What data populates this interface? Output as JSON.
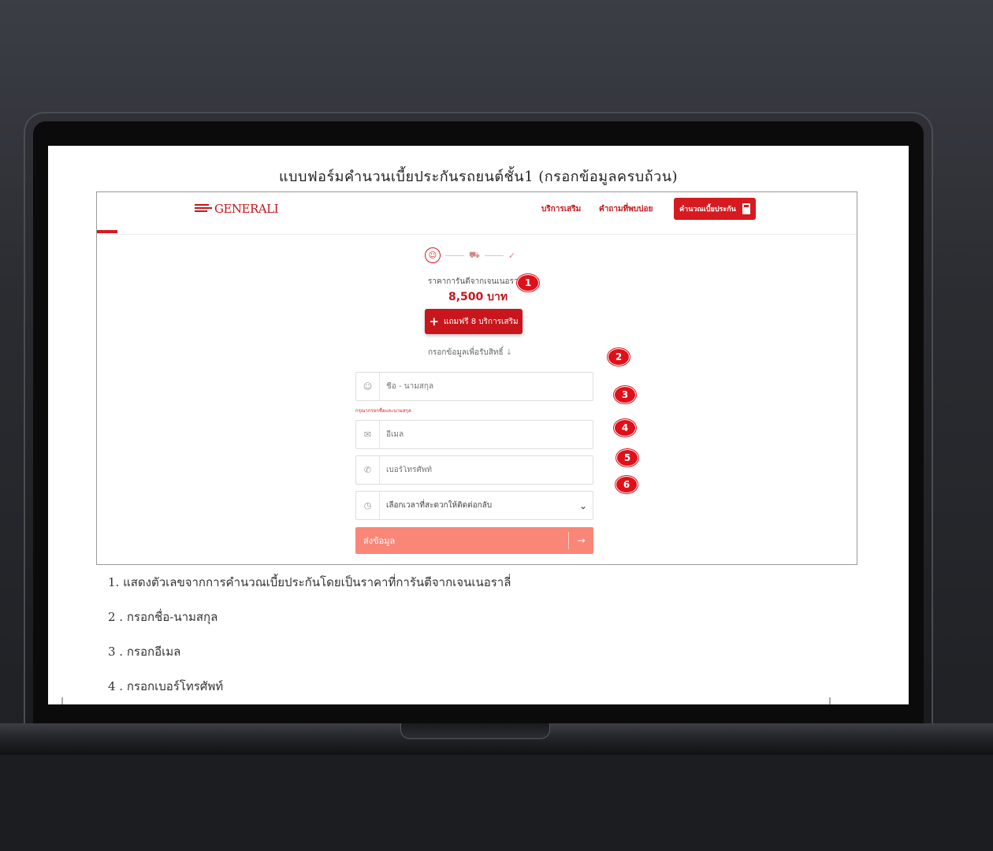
{
  "document": {
    "title": "แบบฟอร์มคำนวนเบี้ยประกันรถยนต์ชั้น1 (กรอกข้อมูลครบถ้วน)",
    "notes": [
      "1. แสดงตัวเลขจากการคำนวณเบี้ยประกันโดยเป็นราคาที่การันตีจากเจนเนอราลี่",
      "2 . กรอกชื่อ-นามสกุล",
      "3 . กรอกอีเมล",
      "4 . กรอกเบอร์โทรศัพท์"
    ]
  },
  "site": {
    "logo_text": "GENERALI",
    "nav": {
      "services": "บริการเสริม",
      "faq": "คำถามที่พบบ่อย",
      "cta": "คำนวณเบี้ยประกัน"
    },
    "steps_icons": [
      "person-icon",
      "car-icon",
      "check-icon"
    ],
    "price_label": "ราคาการันตีจากเจนเนอราลี่",
    "price": "8,500 บาท",
    "free_button": "แถมฟรี 8 บริการเสริม",
    "fill_hint": "กรอกข้อมูลเพื่อรับสิทธิ์",
    "fields": {
      "name_placeholder": "ชื่อ - นามสกุล",
      "name_error": "กรุณากรอกชื่อและนามสกุล",
      "email_placeholder": "อีเมล",
      "phone_placeholder": "เบอร์โทรศัพท์",
      "time_select": "เลือกเวลาที่สะดวกให้ติดต่อกลับ"
    },
    "submit_label": "ส่งข้อมูล"
  },
  "badges": [
    "1",
    "2",
    "3",
    "4",
    "5",
    "6"
  ],
  "colors": {
    "brand_red": "#d71920",
    "submit_salmon": "#fa8677",
    "badge_red": "#e0101a"
  }
}
